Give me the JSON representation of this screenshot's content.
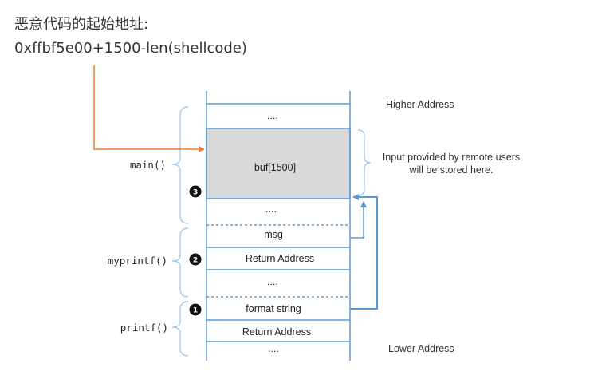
{
  "header": {
    "line1": "恶意代码的起始地址:",
    "line2": "0xffbf5e00+1500-len(shellcode)"
  },
  "stack": {
    "top_dots": "....",
    "buf": "buf[1500]",
    "dots_after_buf": "....",
    "msg": "msg",
    "ret_addr_myprintf": "Return Address",
    "dots_mid": "....",
    "format_string": "format string",
    "ret_addr_printf": "Return Address",
    "bottom_dots": "...."
  },
  "labels": {
    "higher": "Higher Address",
    "lower": "Lower Address",
    "input_line1": "Input provided by remote users",
    "input_line2": "will be stored here."
  },
  "frames": {
    "main": "main()",
    "myprintf": "myprintf()",
    "printf": "printf()"
  },
  "badges": {
    "b1": "1",
    "b2": "2",
    "b3": "3"
  },
  "colors": {
    "stack_line": "#5b9bd5",
    "arrow_orange": "#ed7d31",
    "buf_fill": "#d9d9d9",
    "brace": "#9dc3e6"
  }
}
